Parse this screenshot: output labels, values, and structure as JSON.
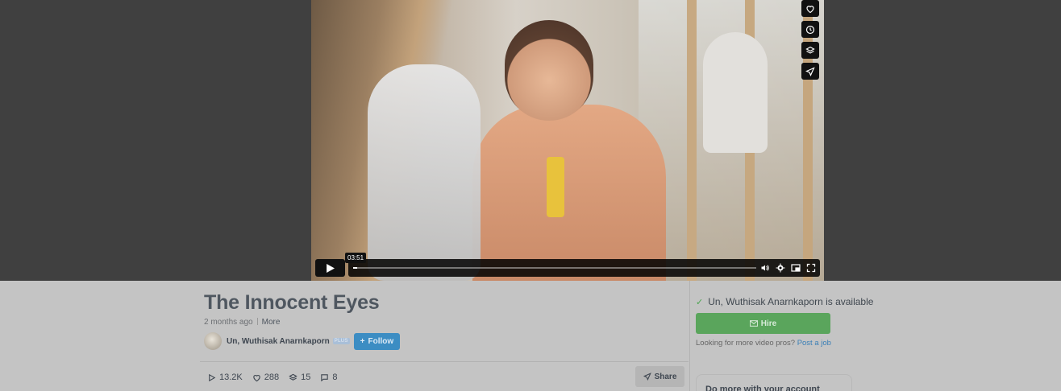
{
  "player": {
    "time_label": "03:51",
    "progress": 0.01,
    "side_icons": [
      "heart-icon",
      "clock-icon",
      "layers-icon",
      "send-icon"
    ],
    "control_icons": [
      "volume-icon",
      "gear-icon",
      "pip-icon",
      "fullscreen-icon"
    ]
  },
  "video": {
    "title": "The Innocent Eyes",
    "age": "2 months ago",
    "more_label": "More"
  },
  "owner": {
    "name": "Un, Wuthisak Anarnkaporn",
    "badge": "PLUS",
    "follow_label": "Follow"
  },
  "stats": {
    "plays": "13.2K",
    "likes": "288",
    "collections": "15",
    "comments": "8",
    "share_label": "Share"
  },
  "sidebar": {
    "availability": "Un, Wuthisak Anarnkaporn is available",
    "hire_label": "Hire",
    "more_pros_text": "Looking for more video pros?",
    "post_job_label": "Post a job",
    "account_card_text": "Do more with your account"
  },
  "colors": {
    "stage_bg": "#404040",
    "overlay_bg": "#c4c4c4",
    "follow_blue": "#3c8dc3",
    "hire_green": "#5aa55c"
  }
}
